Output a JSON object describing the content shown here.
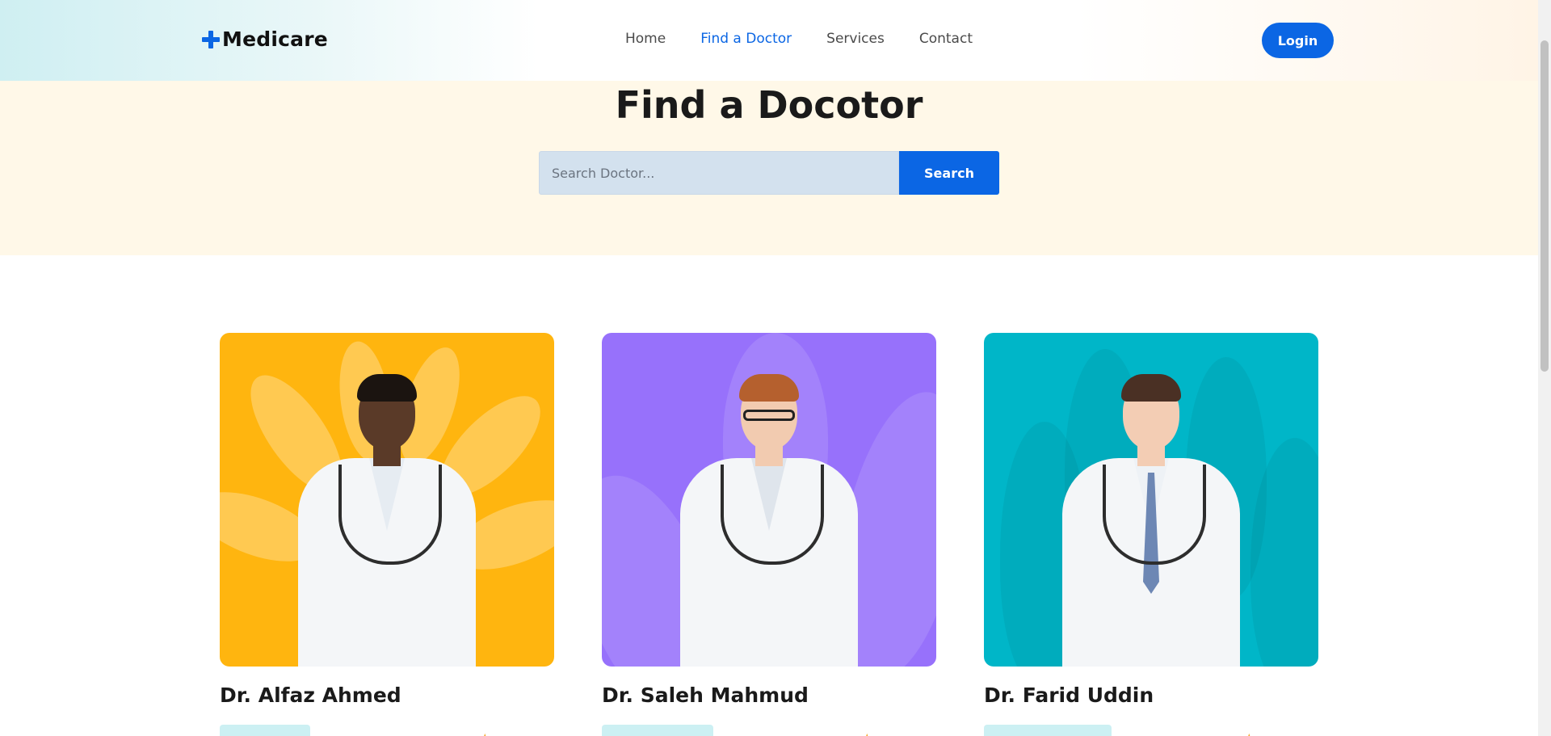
{
  "header": {
    "logo_text": "Medicare",
    "nav": [
      {
        "label": "Home",
        "active": false
      },
      {
        "label": "Find a Doctor",
        "active": true
      },
      {
        "label": "Services",
        "active": false
      },
      {
        "label": "Contact",
        "active": false
      }
    ],
    "login_label": "Login"
  },
  "hero": {
    "title": "Find a Docotor",
    "search_placeholder": "Search Doctor...",
    "search_button": "Search"
  },
  "doctors": [
    {
      "name": "Dr. Alfaz Ahmed",
      "card_bg": "#ffb50f",
      "skin": "#5a3a28",
      "hair": "#1b1410"
    },
    {
      "name": "Dr. Saleh Mahmud",
      "card_bg": "#9771fb",
      "skin": "#f2cbb0",
      "hair": "#b5602e"
    },
    {
      "name": "Dr. Farid Uddin",
      "card_bg": "#00b6c8",
      "skin": "#f3cdb4",
      "hair": "#4a3024"
    }
  ],
  "colors": {
    "primary": "#0b66e4",
    "hero_bg": "#fff8e8",
    "tag_bg": "#ccf0f3",
    "star": "#f5a623"
  }
}
